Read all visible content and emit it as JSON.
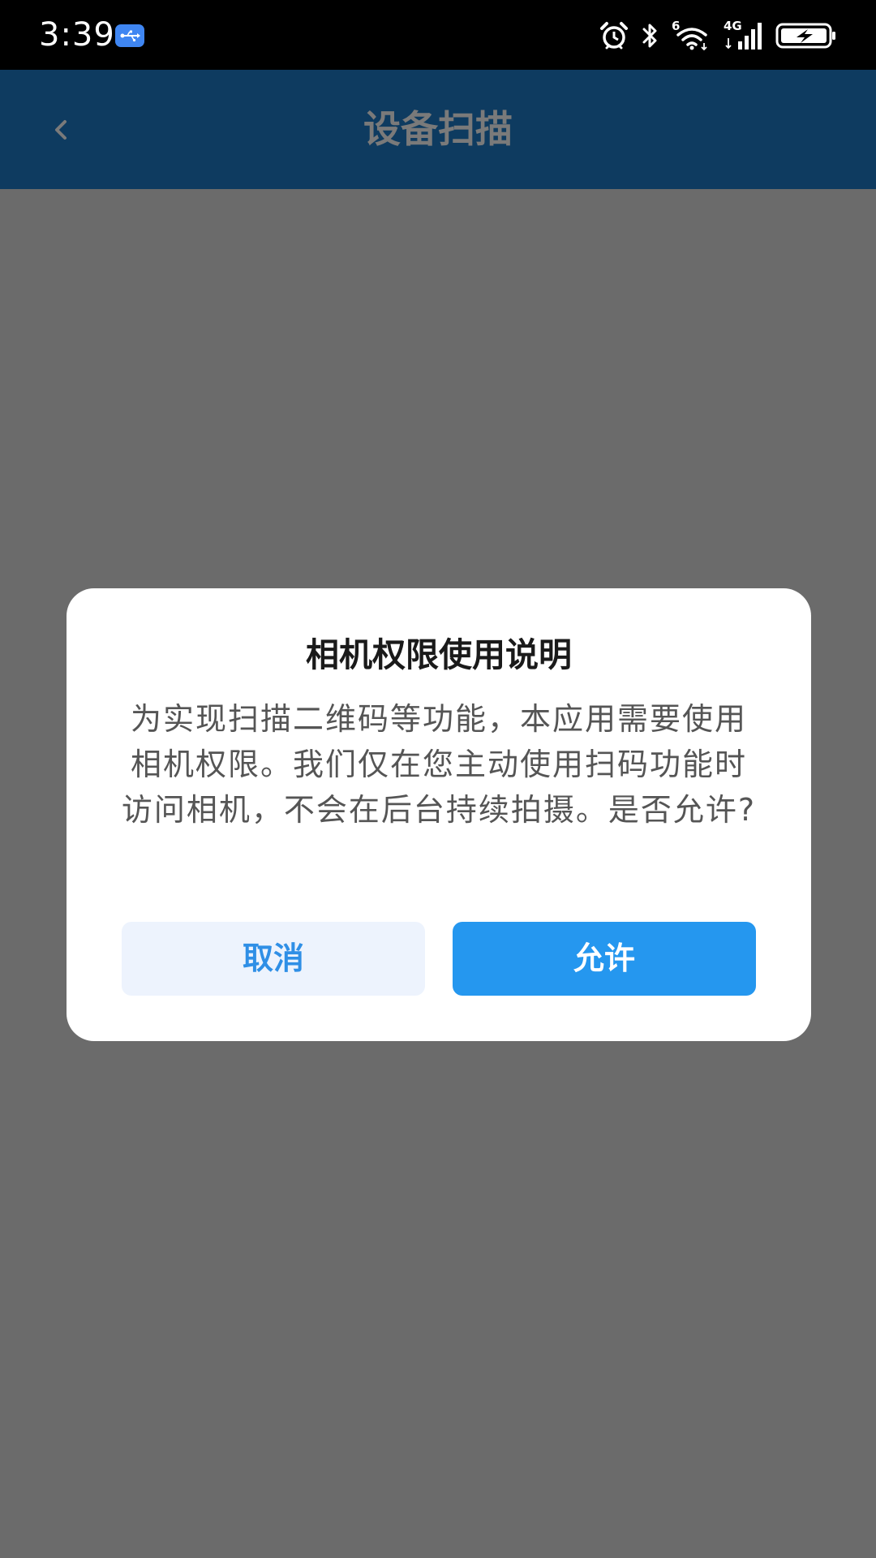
{
  "status_bar": {
    "time": "3:39",
    "network_label": "4G",
    "wifi_label": "6"
  },
  "header": {
    "title": "设备扫描"
  },
  "dialog": {
    "title": "相机权限使用说明",
    "message": "为实现扫描二维码等功能，本应用需要使用相机权限。我们仅在您主动使用扫码功能时访问相机，不会在后台持续拍摄。是否允许?",
    "cancel_label": "取消",
    "allow_label": "允许"
  },
  "colors": {
    "header_bg": "#0e3b60",
    "overlay_bg": "#6b6b6b",
    "primary": "#2597ef",
    "secondary_bg": "#edf3fd"
  },
  "icons": {
    "usb": "usb-icon",
    "alarm": "alarm-icon",
    "bluetooth": "bluetooth-icon",
    "wifi": "wifi-icon",
    "signal": "signal-icon",
    "battery": "battery-charging-icon",
    "back": "chevron-left-icon"
  }
}
